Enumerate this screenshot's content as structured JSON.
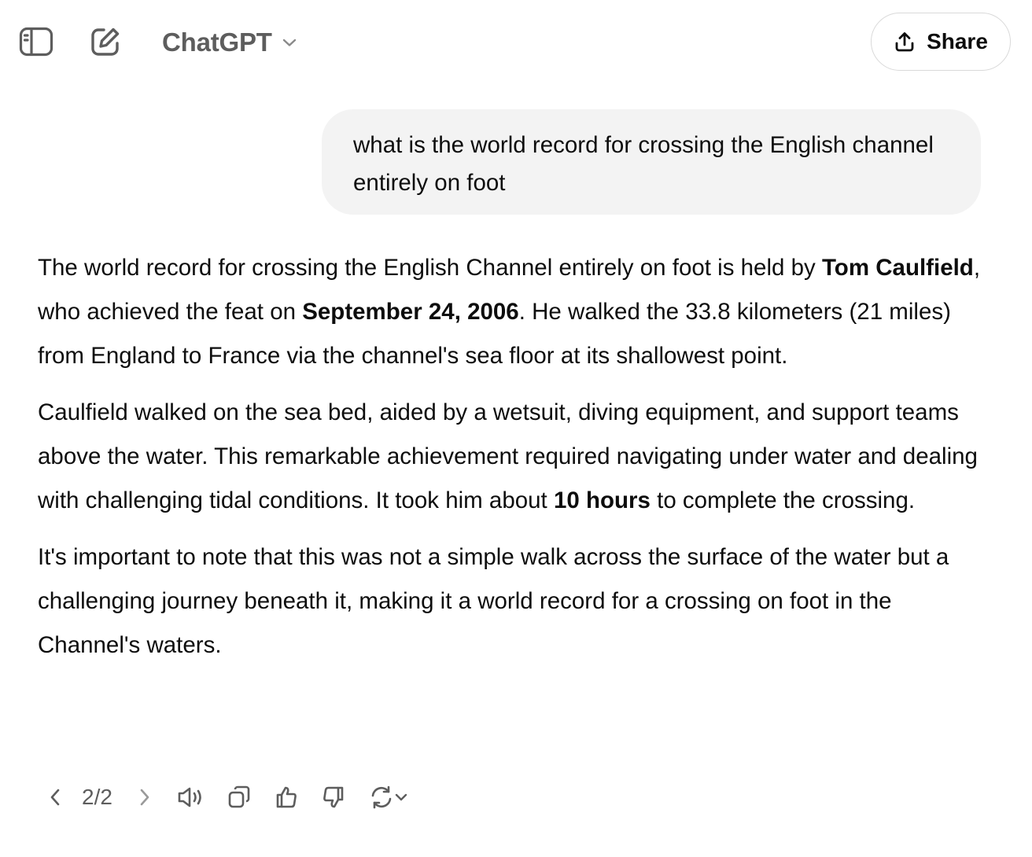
{
  "header": {
    "model_name": "ChatGPT",
    "share_label": "Share"
  },
  "conversation": {
    "user_message": "what is the world record for crossing the English channel entirely on foot",
    "assistant": {
      "p1": {
        "a": "The world record for crossing the English Channel entirely on foot is held by ",
        "b1": "Tom Caulfield",
        "c": ", who achieved the feat on ",
        "b2": "September 24, 2006",
        "d": ". He walked the 33.8 kilometers (21 miles) from England to France via the channel's sea floor at its shallowest point."
      },
      "p2": {
        "a": "Caulfield walked on the sea bed, aided by a wetsuit, diving equipment, and support teams above the water. This remarkable achievement required navigating under water and dealing with challenging tidal conditions. It took him about ",
        "b1": "10 hours",
        "c": " to complete the crossing."
      },
      "p3": "It's important to note that this was not a simple walk across the surface of the water but a challenging journey beneath it, making it a world record for a crossing on foot in the Channel's waters."
    }
  },
  "response_actions": {
    "pager": "2/2"
  },
  "icons": {
    "sidebar": "sidebar-toggle-icon",
    "new_chat": "new-chat-icon",
    "model_chevron": "chevron-down-icon",
    "share": "share-upload-icon",
    "prev": "chevron-left-icon",
    "next": "chevron-right-icon",
    "read_aloud": "speaker-icon",
    "copy": "copy-icon",
    "thumbs_up": "thumbs-up-icon",
    "thumbs_down": "thumbs-down-icon",
    "regenerate": "regenerate-icon"
  },
  "colors": {
    "bubble_bg": "#f3f3f3",
    "text": "#0d0d0d",
    "muted": "#5d5d5d"
  }
}
